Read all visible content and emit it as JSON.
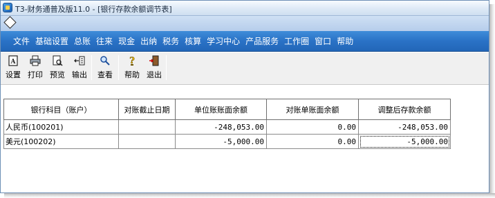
{
  "window": {
    "title": "T3-财务通普及版11.0 - [银行存款余额调节表]"
  },
  "menu": {
    "items": [
      "文件",
      "基础设置",
      "总账",
      "往来",
      "现金",
      "出纳",
      "税务",
      "核算",
      "学习中心",
      "产品服务",
      "工作圈",
      "窗口",
      "帮助"
    ]
  },
  "toolbar": {
    "setup": "设置",
    "print": "打印",
    "preview": "预览",
    "export": "输出",
    "view": "查看",
    "help": "帮助",
    "exit": "退出"
  },
  "grid": {
    "headers": [
      "银行科目（账户）",
      "对账截止日期",
      "单位账账面余额",
      "对账单账面余额",
      "调整后存款余额"
    ],
    "rows": [
      {
        "account": "人民币(100201)",
        "cutoff_date": "",
        "book_balance": "-248,053.00",
        "statement_balance": "0.00",
        "adjusted_balance": "-248,053.00"
      },
      {
        "account": "美元(100202)",
        "cutoff_date": "",
        "book_balance": "-5,000.00",
        "statement_balance": "0.00",
        "adjusted_balance": "-5,000.00"
      }
    ]
  },
  "colors": {
    "menubar": "#2a72c6",
    "titlebar": "#dde9f6"
  }
}
